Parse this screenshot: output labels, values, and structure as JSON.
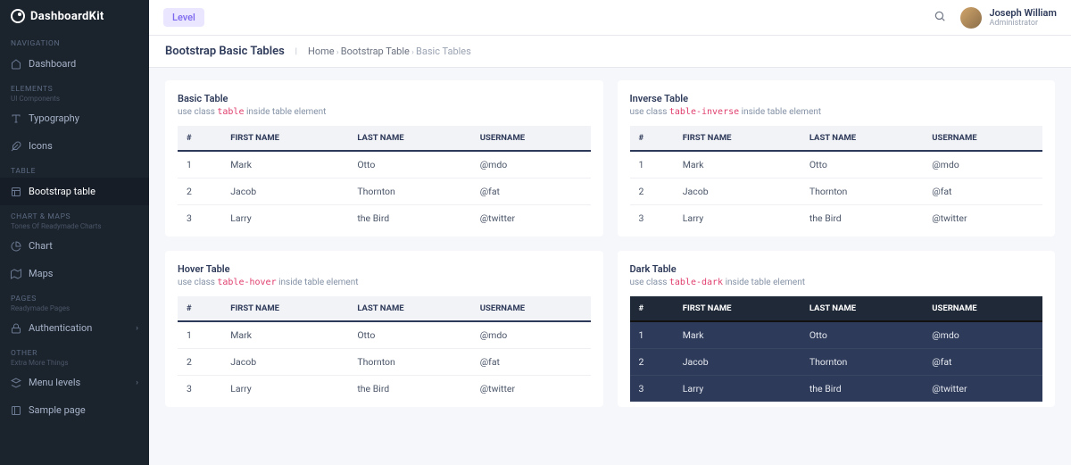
{
  "brand": {
    "name": "DashboardKit"
  },
  "sidebar": {
    "sections": [
      {
        "label": "NAVIGATION",
        "subtitle": "",
        "items": [
          {
            "label": "Dashboard",
            "icon": "home"
          }
        ]
      },
      {
        "label": "ELEMENTS",
        "subtitle": "UI Components",
        "items": [
          {
            "label": "Typography",
            "icon": "type"
          },
          {
            "label": "Icons",
            "icon": "feather"
          }
        ]
      },
      {
        "label": "TABLE",
        "subtitle": "",
        "items": [
          {
            "label": "Bootstrap table",
            "icon": "table",
            "active": true
          }
        ]
      },
      {
        "label": "CHART & MAPS",
        "subtitle": "Tones Of Readymade Charts",
        "items": [
          {
            "label": "Chart",
            "icon": "pie"
          },
          {
            "label": "Maps",
            "icon": "map"
          }
        ]
      },
      {
        "label": "PAGES",
        "subtitle": "Readymade Pages",
        "items": [
          {
            "label": "Authentication",
            "icon": "lock",
            "expandable": true
          }
        ]
      },
      {
        "label": "OTHER",
        "subtitle": "Extra More Things",
        "items": [
          {
            "label": "Menu levels",
            "icon": "layers",
            "expandable": true
          },
          {
            "label": "Sample page",
            "icon": "sidebar"
          }
        ]
      }
    ]
  },
  "topbar": {
    "level_label": "Level",
    "user_name": "Joseph William",
    "user_role": "Administrator"
  },
  "breadcrumb": {
    "title": "Bootstrap Basic Tables",
    "items": [
      "Home",
      "Bootstrap Table",
      "Basic Tables"
    ]
  },
  "cards": [
    {
      "title": "Basic Table",
      "desc_prefix": "use class ",
      "desc_code": "table",
      "desc_suffix": " inside table element",
      "dark": false
    },
    {
      "title": "Inverse Table",
      "desc_prefix": "use class ",
      "desc_code": "table-inverse",
      "desc_suffix": " inside table element",
      "dark": false
    },
    {
      "title": "Hover Table",
      "desc_prefix": "use class ",
      "desc_code": "table-hover",
      "desc_suffix": " inside table element",
      "dark": false
    },
    {
      "title": "Dark Table",
      "desc_prefix": "use class ",
      "desc_code": "table-dark",
      "desc_suffix": " inside table element",
      "dark": true
    }
  ],
  "table": {
    "headers": [
      "#",
      "FIRST NAME",
      "LAST NAME",
      "USERNAME"
    ],
    "rows": [
      [
        "1",
        "Mark",
        "Otto",
        "@mdo"
      ],
      [
        "2",
        "Jacob",
        "Thornton",
        "@fat"
      ],
      [
        "3",
        "Larry",
        "the Bird",
        "@twitter"
      ]
    ]
  }
}
